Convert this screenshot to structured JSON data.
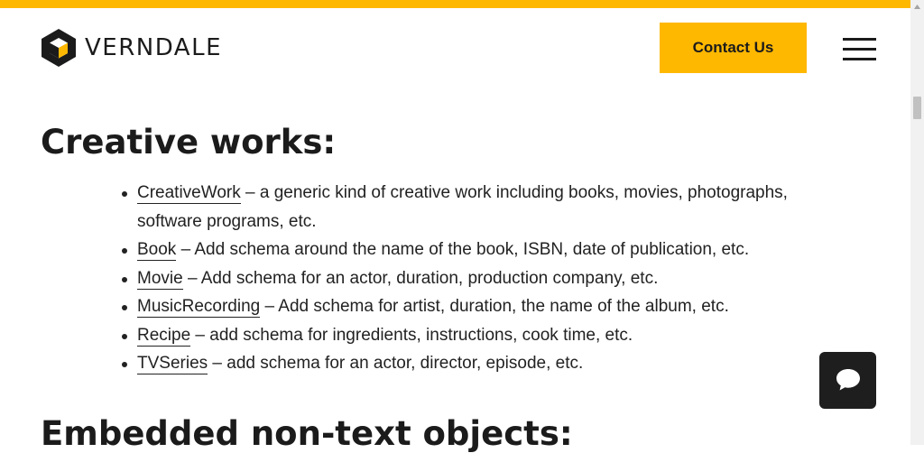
{
  "brand": {
    "name": "VERNDALE",
    "accent_color": "#FFB800"
  },
  "header": {
    "contact_label": "Contact Us",
    "menu_icon": "hamburger-menu-icon"
  },
  "section": {
    "title": "Creative works:",
    "items": [
      {
        "link": "CreativeWork",
        "text": " – a generic kind of creative work including books, movies, photographs, software programs, etc."
      },
      {
        "link": "Book",
        "text": " – Add schema around the name of the book, ISBN, date of publication, etc."
      },
      {
        "link": "Movie",
        "text": " – Add schema for an actor, duration, production company, etc."
      },
      {
        "link": "MusicRecording",
        "text": " – Add schema for artist, duration, the name of the album, etc."
      },
      {
        "link": "Recipe",
        "text": " – add schema for ingredients, instructions, cook time, etc."
      },
      {
        "link": "TVSeries",
        "text": " – add schema for an actor, director, episode, etc."
      }
    ]
  },
  "next_section": {
    "title": "Embedded non-text objects:"
  },
  "chat": {
    "icon": "chat-bubble-icon"
  }
}
